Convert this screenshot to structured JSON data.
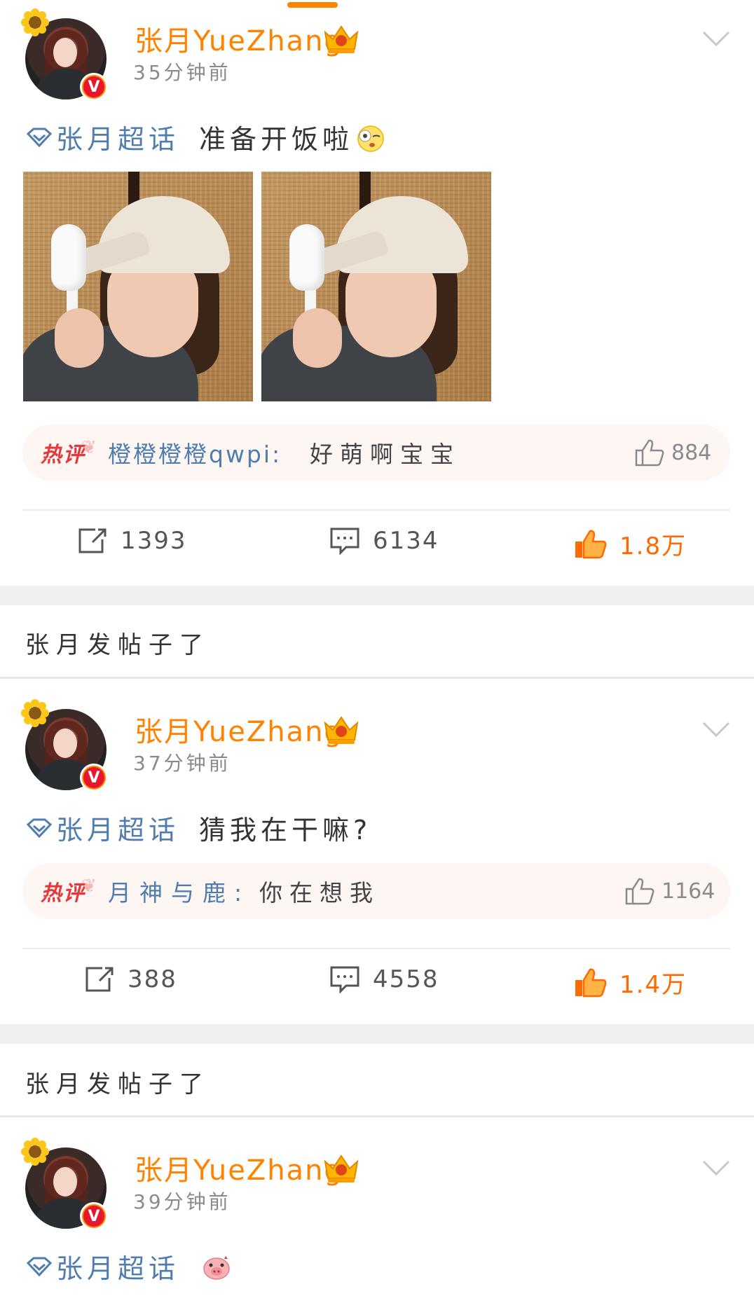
{
  "posts": [
    {
      "username": "张月YueZhang",
      "time": "35分钟前",
      "topic": "张月超话",
      "text": "准备开饭啦",
      "hot_badge": "热评",
      "hot_user": "橙橙橙橙qwpi:",
      "hot_text": "好萌啊宝宝",
      "hot_likes": "884",
      "reposts": "1393",
      "comments": "6134",
      "likes": "1.8万"
    },
    {
      "username": "张月YueZhang",
      "time": "37分钟前",
      "topic": "张月超话",
      "text": "猜我在干嘛?",
      "hot_badge": "热评",
      "hot_user": "月神与鹿:",
      "hot_text": "你在想我",
      "hot_likes": "1164",
      "reposts": "388",
      "comments": "4558",
      "likes": "1.4万"
    },
    {
      "username": "张月YueZhang",
      "time": "39分钟前",
      "topic": "张月超话",
      "text": ""
    }
  ],
  "section_titles": [
    "张月发帖子了",
    "张月发帖子了"
  ],
  "colors": {
    "accent": "#ff8200",
    "link": "#507daf",
    "hot": "#e23a3a",
    "liked": "#ff6a00"
  },
  "icons": [
    "sunflower-icon",
    "verified-v-icon",
    "crown-icon",
    "chevron-down-icon",
    "topic-diamond-icon",
    "thumb-up-icon",
    "repost-icon",
    "comment-icon"
  ]
}
